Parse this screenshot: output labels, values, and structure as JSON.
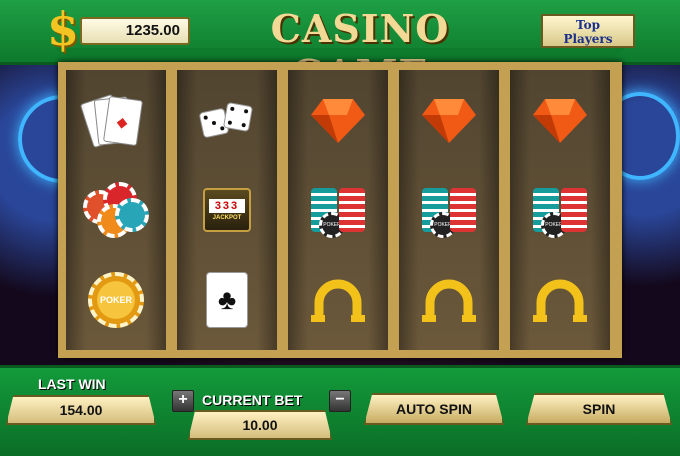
{
  "header": {
    "currency_symbol": "$",
    "balance": "1235.00",
    "title": "CASINO GAME",
    "top_players_label": "Top\nPlayers"
  },
  "reels": [
    [
      "cards-icon",
      "red-chips-icon",
      "poker-chip-icon"
    ],
    [
      "dice-icon",
      "jackpot-slot-icon",
      "club-card-icon"
    ],
    [
      "diamond-gem-icon",
      "poker-chip-stacks-icon",
      "horseshoe-icon"
    ],
    [
      "diamond-gem-icon",
      "poker-chip-stacks-icon",
      "horseshoe-icon"
    ],
    [
      "diamond-gem-icon",
      "poker-chip-stacks-icon",
      "horseshoe-icon"
    ]
  ],
  "symbols": {
    "jackpot_digits": "333",
    "jackpot_text": "JACKPOT",
    "poker_text": "POKER"
  },
  "footer": {
    "last_win_label": "LAST WIN",
    "last_win_value": "154.00",
    "plus_label": "+",
    "current_bet_label": "CURRENT BET",
    "minus_label": "−",
    "current_bet_value": "10.00",
    "auto_spin_label": "AUTO SPIN",
    "spin_label": "SPIN"
  },
  "colors": {
    "green": "#129a3c",
    "gold": "#c4a052",
    "gem": "#f05a14",
    "horseshoe": "#f3c21a"
  }
}
